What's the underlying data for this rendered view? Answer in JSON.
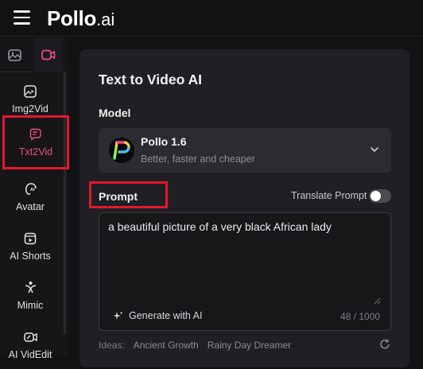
{
  "app": {
    "logo_main": "Pollo",
    "logo_suffix": ".ai"
  },
  "sidebar": {
    "tabs": [
      {
        "icon": "image-icon"
      },
      {
        "icon": "video-icon"
      }
    ],
    "items": [
      {
        "label": "Img2Vid",
        "icon": "image-video-icon"
      },
      {
        "label": "Txt2Vid",
        "icon": "text-video-icon",
        "active": true
      },
      {
        "label": "Avatar",
        "icon": "avatar-icon"
      },
      {
        "label": "AI Shorts",
        "icon": "shorts-icon"
      },
      {
        "label": "Mimic",
        "icon": "mimic-icon"
      },
      {
        "label": "AI VidEdit",
        "icon": "video-edit-icon"
      }
    ]
  },
  "panel": {
    "title": "Text to Video AI",
    "model_label": "Model",
    "model": {
      "name": "Pollo 1.6",
      "description": "Better, faster and cheaper"
    },
    "prompt_label": "Prompt",
    "translate_label": "Translate Prompt",
    "translate_enabled": false,
    "prompt_value": "a beautiful picture of a very black African lady",
    "generate_label": "Generate with AI",
    "counter": "48 / 1000",
    "ideas_label": "Ideas:",
    "ideas": [
      "Ancient Growth",
      "Rainy Day Dreamer"
    ]
  },
  "colors": {
    "accent_pink": "#ef4f7e",
    "highlight_red": "#e3182d",
    "background": "#121214",
    "panel": "#202024"
  }
}
